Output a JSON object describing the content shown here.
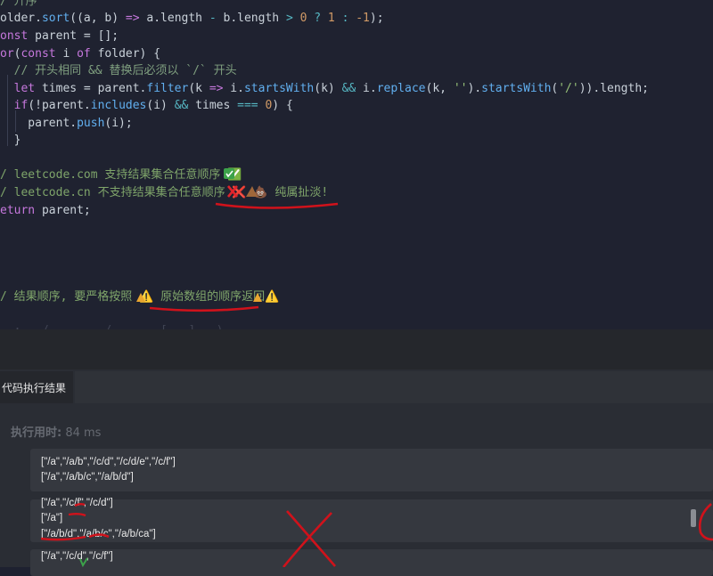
{
  "editor": {
    "lines": [
      "/ 升序",
      "older.sort((a, b) => a.length - b.length > 0 ? 1 : -1);",
      "onst parent = [];",
      "or(const i of folder) {",
      "  // 开头相同 && 替换后必须以 `/` 开头",
      "  let times = parent.filter(k => i.startsWith(k) && i.replace(k, '').startsWith('/')).length;",
      "  if(!parent.includes(i) && times === 0) {",
      "    parent.push(i);",
      "  }",
      "/ leetcode.com 支持结果集合任意顺序 ✅",
      "/ leetcode.cn 不支持结果集合任意顺序 ❌ 💩 纯属扯淡!",
      "eturn parent;",
      "/ 结果顺序, 要严格按照 ⚠️ 原始数组的顺序返回⚠️"
    ]
  },
  "icons": {
    "check": "white-heavy-check-mark-icon",
    "cross": "cross-mark-icon",
    "poop": "pile-of-poo-icon",
    "warning": "warning-icon"
  },
  "panel": {
    "tab_label": "代码执行结果",
    "exec_label": "执行用时:",
    "exec_value": "84 ms",
    "box1": [
      "[\"/a\",\"/a/b\",\"/c/d\",\"/c/d/e\",\"/c/f\"]",
      "[\"/a\",\"/a/b/c\",\"/a/b/d\"]"
    ],
    "box2": [
      "[\"/a\",\"/c/f\",\"/c/d\"]",
      "[\"/a\"]",
      "[\"/a/b/d\",\"/a/b/c\",\"/a/b/ca\"]"
    ],
    "box3": [
      "[\"/a\",\"/c/d\",\"/c/f\"]"
    ]
  },
  "colors": {
    "annotation_red": "#d0121b",
    "editor_bg": "#1f2230",
    "panel_bg": "#2a2d34"
  }
}
